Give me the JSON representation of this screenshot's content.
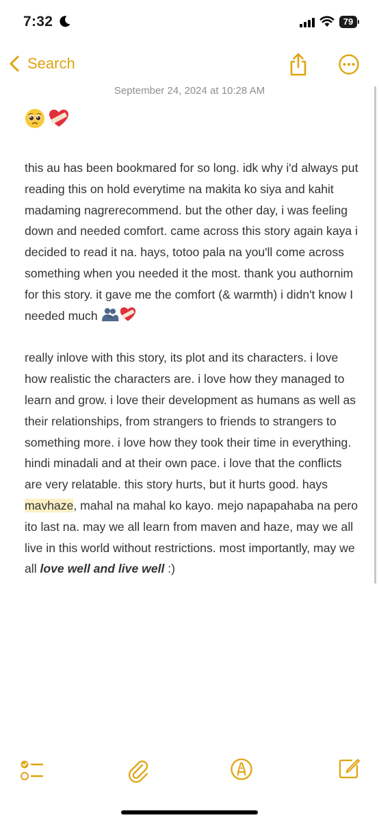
{
  "status": {
    "time": "7:32",
    "battery": "79"
  },
  "nav": {
    "back_label": "Search"
  },
  "note": {
    "date": "September 24, 2024 at 10:28 AM",
    "emojis": [
      "pleading-face-emoji",
      "mending-heart-emoji"
    ],
    "paragraph1": "this au has been bookmared for so long. idk why i'd always put reading this on hold everytime na makita ko siya and kahit madaming nagrerecommend. but the other day, i was feeling down and needed comfort. came across this story again kaya i decided to read it na. hays, totoo pala na you'll come across something when you needed it the most. thank you authornim for this story. it gave me the comfort (& warmth) i didn't know I needed much",
    "paragraph1_emojis": [
      "people-hugging-emoji",
      "mending-heart-emoji"
    ],
    "paragraph2_before": "really inlove with this story, its plot and its characters. i love how realistic the characters are. i love how they managed to learn and grow. i love their development as humans as well as their relationships, from strangers to friends to strangers to something more. i love how they took their time in everything. hindi minadali and at their own pace. i love that the conflicts are very relatable. this story hurts, but it hurts good. hays ",
    "paragraph2_highlight": "mavhaze",
    "paragraph2_middle": ", mahal na mahal ko kayo. mejo napapahaba na pero ito last na. may we all learn from maven and haze, may we all live in this world without restrictions. most importantly, may we all ",
    "paragraph2_emphasis": "love well and live well",
    "paragraph2_end": " :)"
  },
  "toolbar": {
    "icons": [
      "checklist-icon",
      "attachment-icon",
      "markup-icon",
      "compose-icon"
    ]
  },
  "colors": {
    "accent": "#dfa410",
    "highlight": "#fbf0c4",
    "text": "#333336",
    "date": "#8e8e93"
  }
}
